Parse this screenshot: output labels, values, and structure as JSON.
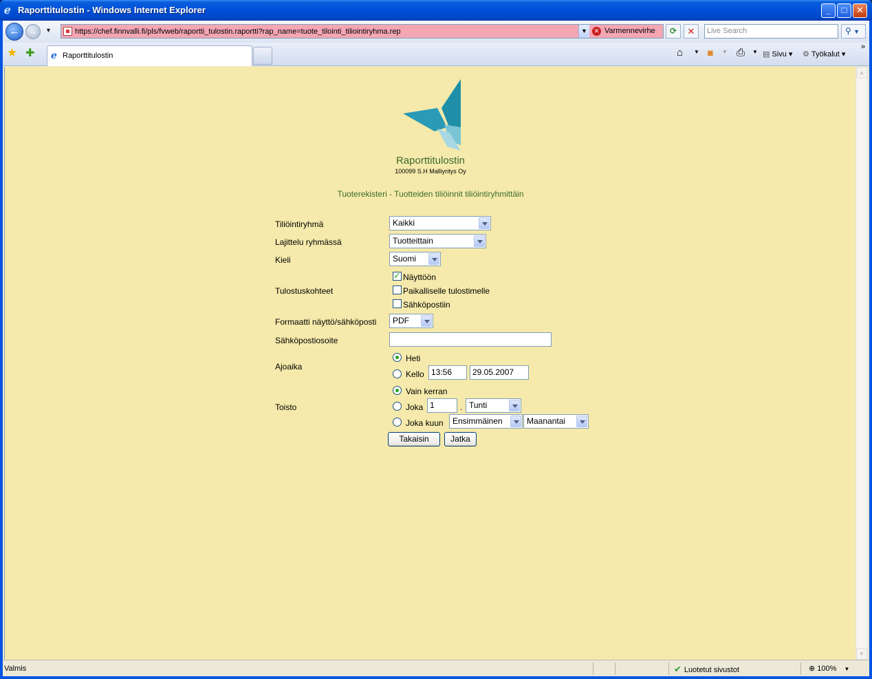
{
  "window": {
    "title": "Raporttitulostin - Windows Internet Explorer",
    "minimize": "_",
    "maximize": "□",
    "close": "✕"
  },
  "navigation": {
    "back_icon": "back-arrow-icon",
    "forward_icon": "forward-arrow-icon",
    "url": "https://chef.finnvalli.fi/pls/fvweb/raportti_tulostin.raportti?rap_name=tuote_tilointi_tiliointiryhma.rep",
    "certificate_error": "Varmennevirhe",
    "search_placeholder": "Live Search"
  },
  "tabs": [
    {
      "label": "Raporttitulostin"
    }
  ],
  "command_bar": {
    "page_label": "Sivu",
    "tools_label": "Työkalut",
    "more": "»"
  },
  "page": {
    "app_name": "Raporttitulostin",
    "company": "100099 S.H Malliyritys Oy",
    "report_title": "Tuoterekisteri - Tuotteiden tiliöinnit tiliöintiryhmittäin",
    "form": {
      "accounting_group": {
        "label": "Tiliöintiryhmä",
        "value": "Kaikki"
      },
      "sort_in_group": {
        "label": "Lajittelu ryhmässä",
        "value": "Tuotteittain"
      },
      "language": {
        "label": "Kieli",
        "value": "Suomi"
      },
      "print_targets": {
        "label": "Tulostuskohteet",
        "options": [
          {
            "label": "Näyttöön",
            "checked": true
          },
          {
            "label": "Paikalliselle tulostimelle",
            "checked": false
          },
          {
            "label": "Sähköpostiin",
            "checked": false
          }
        ]
      },
      "format": {
        "label": "Formaatti näyttö/sähköposti",
        "value": "PDF"
      },
      "email_address": {
        "label": "Sähköpostiosoite",
        "value": ""
      },
      "run_time": {
        "label": "Ajoaika",
        "now_label": "Heti",
        "at_label": "Kello",
        "time_value": "13:56",
        "date_value": "29.05.2007",
        "selected": "now"
      },
      "repeat": {
        "label": "Toisto",
        "once_label": "Vain kerran",
        "every_label": "Joka",
        "every_value": "1",
        "every_sep": ".",
        "every_unit": "Tunti",
        "monthly_label": "Joka kuun",
        "monthly_ordinal": "Ensimmäinen",
        "monthly_day": "Maanantai",
        "selected": "once"
      },
      "back_button": "Takaisin",
      "continue_button": "Jatka"
    }
  },
  "status_bar": {
    "status": "Valmis",
    "zone": "Luotetut sivustot",
    "zoom": "100%"
  }
}
